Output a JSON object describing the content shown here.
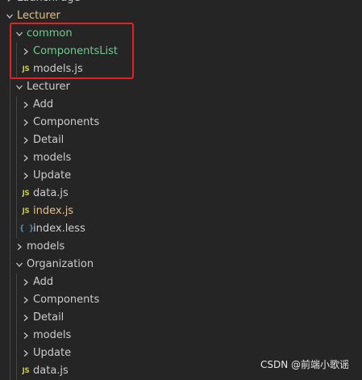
{
  "explorer": {
    "rows": [
      {
        "depth": 0,
        "type": "folder",
        "open": false,
        "label": "LaunchPage",
        "color": "default"
      },
      {
        "depth": 0,
        "type": "folder",
        "open": true,
        "label": "Lecturer",
        "color": "yellow"
      },
      {
        "depth": 1,
        "type": "folder",
        "open": true,
        "label": "common",
        "color": "green"
      },
      {
        "depth": 2,
        "type": "folder",
        "open": false,
        "label": "ComponentsList",
        "color": "green"
      },
      {
        "depth": 2,
        "type": "js",
        "label": "models.js",
        "color": "default"
      },
      {
        "depth": 1,
        "type": "folder",
        "open": true,
        "label": "Lecturer",
        "color": "default"
      },
      {
        "depth": 2,
        "type": "folder",
        "open": false,
        "label": "Add",
        "color": "default"
      },
      {
        "depth": 2,
        "type": "folder",
        "open": false,
        "label": "Components",
        "color": "default"
      },
      {
        "depth": 2,
        "type": "folder",
        "open": false,
        "label": "Detail",
        "color": "default"
      },
      {
        "depth": 2,
        "type": "folder",
        "open": false,
        "label": "models",
        "color": "default"
      },
      {
        "depth": 2,
        "type": "folder",
        "open": false,
        "label": "Update",
        "color": "default"
      },
      {
        "depth": 2,
        "type": "js",
        "label": "data.js",
        "color": "default"
      },
      {
        "depth": 2,
        "type": "js",
        "label": "index.js",
        "color": "yellow"
      },
      {
        "depth": 2,
        "type": "less",
        "label": "index.less",
        "color": "default"
      },
      {
        "depth": 1,
        "type": "folder",
        "open": false,
        "label": "models",
        "color": "default"
      },
      {
        "depth": 1,
        "type": "folder",
        "open": true,
        "label": "Organization",
        "color": "default"
      },
      {
        "depth": 2,
        "type": "folder",
        "open": false,
        "label": "Add",
        "color": "default"
      },
      {
        "depth": 2,
        "type": "folder",
        "open": false,
        "label": "Components",
        "color": "default"
      },
      {
        "depth": 2,
        "type": "folder",
        "open": false,
        "label": "Detail",
        "color": "default"
      },
      {
        "depth": 2,
        "type": "folder",
        "open": false,
        "label": "models",
        "color": "default"
      },
      {
        "depth": 2,
        "type": "folder",
        "open": false,
        "label": "Update",
        "color": "default"
      },
      {
        "depth": 2,
        "type": "js",
        "label": "data.js",
        "color": "default"
      }
    ]
  },
  "icons": {
    "js": "JS",
    "less": "{ }",
    "chevron_right": "chevron-right-icon",
    "chevron_down": "chevron-down-icon"
  },
  "colors": {
    "background": "#252526",
    "text": "#cccccc",
    "git_untracked": "#73c991",
    "git_modified": "#e2c08d",
    "js_icon": "#cbcb41",
    "less_icon": "#519aba",
    "highlight_box": "#e02424"
  },
  "watermark": "CSDN @前端小歌谣"
}
